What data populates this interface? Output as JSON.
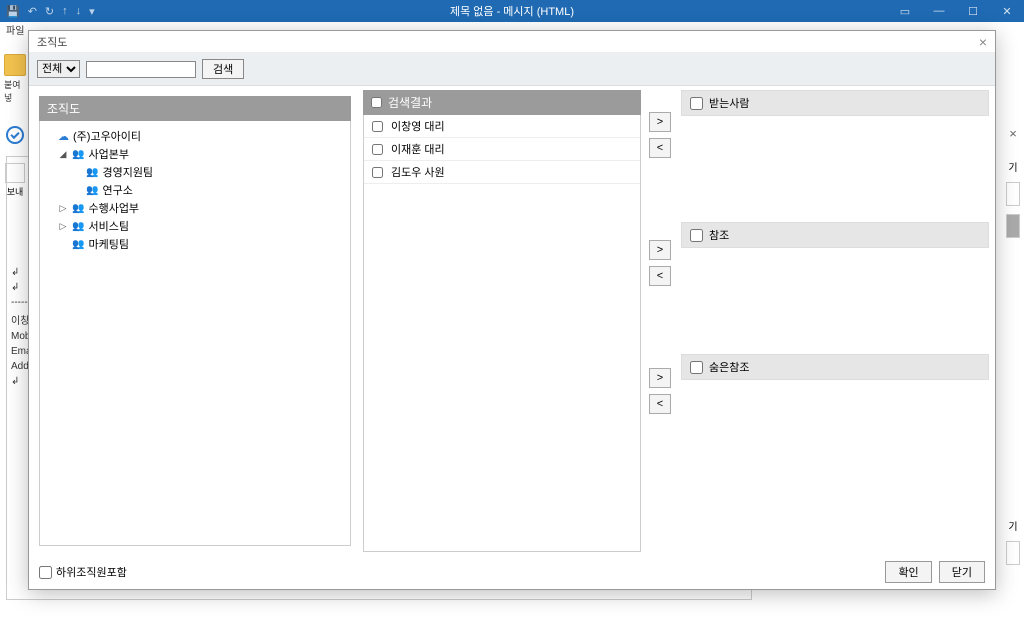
{
  "titlebar": {
    "title": "제목 없음 - 메시지 (HTML)"
  },
  "ribbon": {
    "file": "파일"
  },
  "bg": {
    "paste": "붙여넣",
    "circle_send": "보내",
    "lines": [
      "↲",
      "↲",
      "-----",
      "이창",
      "Mob",
      "Ema",
      "Add",
      "↲"
    ],
    "right_ki": "기"
  },
  "modal": {
    "title": "조직도",
    "search": {
      "scope": "전체",
      "placeholder": "",
      "button": "검색"
    },
    "tree": {
      "header": "조직도",
      "root": "(주)고우아이티",
      "n1": "사업본부",
      "n1a": "경영지원팀",
      "n1b": "연구소",
      "n2": "수행사업부",
      "n3": "서비스팀",
      "n4": "마케팅팀"
    },
    "results": {
      "header": "검색결과",
      "items": [
        "이창영 대리",
        "이재훈 대리",
        "김도우 사원"
      ]
    },
    "move": {
      "add": ">",
      "remove": "<"
    },
    "recip": {
      "to": "받는사람",
      "cc": "참조",
      "bcc": "숨은참조"
    },
    "footer": {
      "include_sub": "하위조직원포함",
      "ok": "확인",
      "close": "닫기"
    }
  }
}
